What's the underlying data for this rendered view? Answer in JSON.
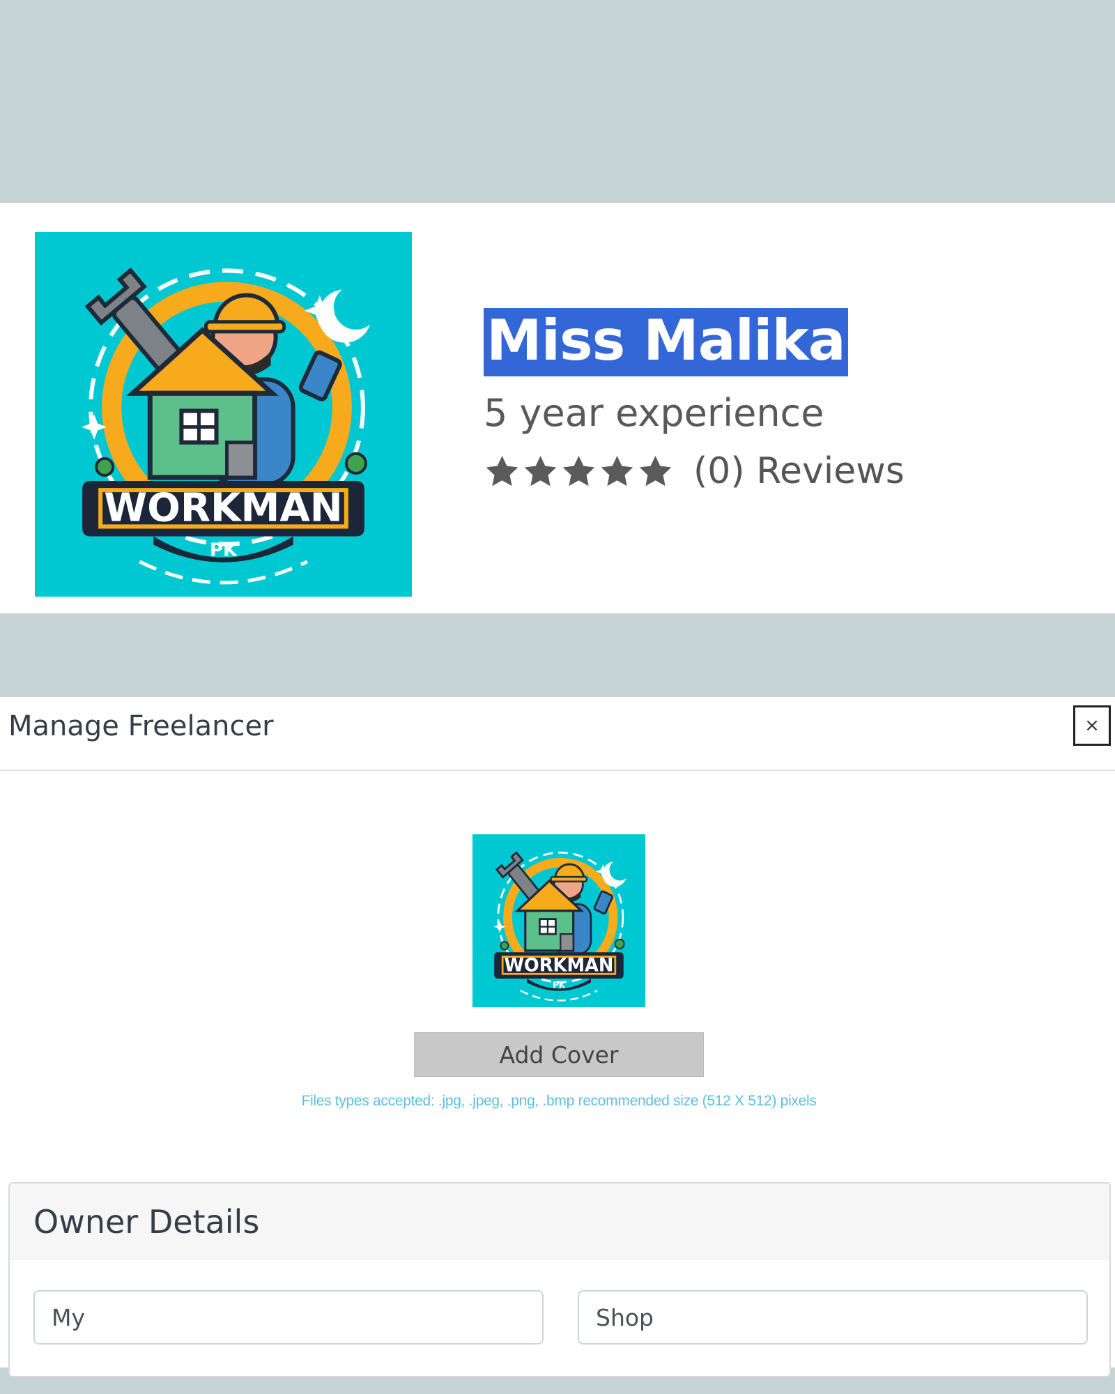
{
  "profile": {
    "name": "Miss Malika",
    "experience": "5 year experience",
    "reviews": "(0) Reviews",
    "rating": 0,
    "rating_max": 5
  },
  "logo": {
    "brand": "WORKMAN",
    "sub": "PK"
  },
  "modal": {
    "title": "Manage Freelancer",
    "close_label": "×",
    "add_cover_label": "Add Cover",
    "file_hint": "Files types accepted: .jpg, .jpeg, .png, .bmp recommended size (512 X 512) pixels"
  },
  "owner": {
    "heading": "Owner Details",
    "first_value": "My",
    "last_value": "Shop"
  },
  "colors": {
    "page_bg": "#c6d3d4",
    "logo_bg": "#00c8d2",
    "logo_accent": "#f6aa1c",
    "highlight": "#3366d6",
    "hint": "#5bc0de"
  }
}
